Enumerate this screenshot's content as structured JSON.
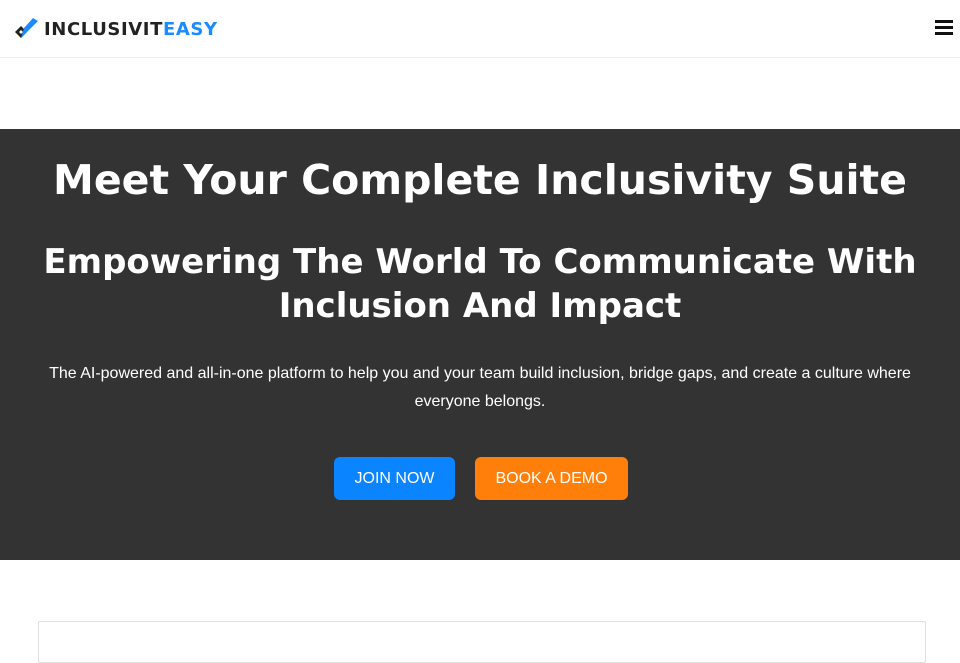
{
  "brand": {
    "name_dark": "INCLUSIVIT",
    "name_accent": "EASY",
    "accent_color": "#1a8cff",
    "dark_color": "#222222",
    "logo_icon": "checkmark-diamond-logo"
  },
  "header": {
    "menu_icon": "hamburger-menu-icon"
  },
  "hero": {
    "background_color": "#333333",
    "title": "Meet Your Complete Inclusivity Suite",
    "subtitle": "Empowering The World To Communicate With Inclusion And Impact",
    "description": "The AI-powered and all-in-one platform to help you and your team build inclusion, bridge gaps, and create a culture where everyone belongs.",
    "buttons": {
      "join_label": "JOIN NOW",
      "join_color": "#0a84ff",
      "demo_label": "BOOK A DEMO",
      "demo_color": "#ff7f0a"
    }
  }
}
